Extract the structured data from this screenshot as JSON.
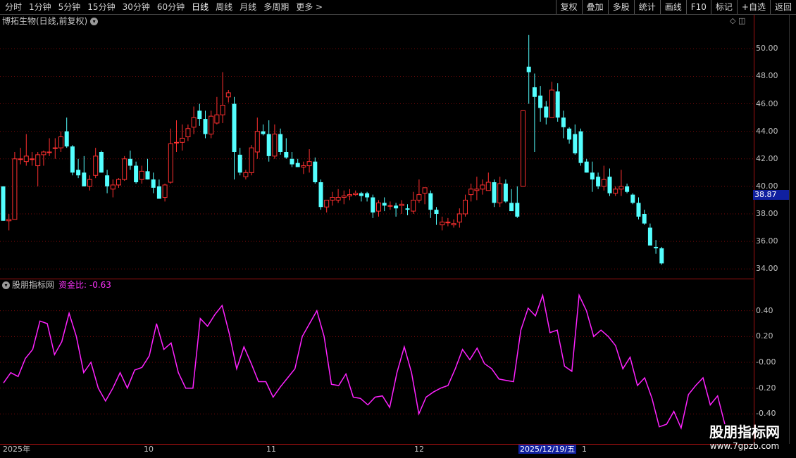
{
  "toolbar": {
    "periods": [
      "分时",
      "1分钟",
      "5分钟",
      "15分钟",
      "30分钟",
      "60分钟",
      "日线",
      "周线",
      "月线",
      "多周期",
      "更多 >"
    ],
    "active_period": "日线",
    "actions": [
      "复权",
      "叠加",
      "多股",
      "统计",
      "画线",
      "F10",
      "标记",
      "+自选",
      "返回"
    ]
  },
  "stock": {
    "title": "博拓生物(日线,前复权)"
  },
  "indicator": {
    "name": "股朋指标网",
    "fund_label": "资金比: -0.63"
  },
  "price_axis": {
    "ticks": [
      "50.00",
      "48.00",
      "46.00",
      "44.00",
      "42.00",
      "40.00",
      "38.00",
      "36.00",
      "34.00"
    ],
    "current": "38.87"
  },
  "ind_axis": {
    "ticks": [
      "0.40",
      "0.20",
      "-0.00",
      "-0.20",
      "-0.40"
    ]
  },
  "date_axis": {
    "labels": [
      "2025年",
      "10",
      "11",
      "12",
      "2025/12/19/五",
      "1"
    ]
  },
  "watermark": {
    "line1": "股朋指标网",
    "line2": "www.7gpzb.com"
  },
  "colors": {
    "up": "#ff3030",
    "down": "#54ffff",
    "line": "#ff22ff",
    "grid": "#7a0a0a"
  },
  "chart_data": [
    {
      "type": "candlestick",
      "title": "博拓生物(日线,前复权)",
      "ylim": [
        33.5,
        51.5
      ],
      "candles": [
        [
          40.0,
          40.0,
          37.5,
          37.5
        ],
        [
          37.5,
          38.0,
          36.8,
          37.6
        ],
        [
          37.6,
          42.5,
          37.6,
          42.0
        ],
        [
          42.0,
          42.8,
          41.6,
          42.0
        ],
        [
          41.8,
          43.8,
          41.5,
          42.2
        ],
        [
          42.0,
          42.5,
          41.5,
          42.0
        ],
        [
          41.5,
          42.5,
          40.0,
          42.3
        ],
        [
          42.3,
          42.6,
          41.5,
          42.5
        ],
        [
          42.5,
          43.5,
          42.2,
          42.5
        ],
        [
          42.8,
          43.5,
          42.0,
          42.8
        ],
        [
          42.8,
          44.0,
          42.5,
          43.6
        ],
        [
          44.0,
          45.0,
          42.8,
          42.9
        ],
        [
          42.9,
          43.0,
          40.8,
          41.0
        ],
        [
          41.2,
          42.0,
          40.6,
          40.8
        ],
        [
          41.0,
          42.2,
          40.0,
          40.0
        ],
        [
          40.0,
          40.8,
          39.7,
          40.5
        ],
        [
          40.8,
          42.8,
          40.6,
          42.2
        ],
        [
          42.5,
          42.6,
          41.0,
          41.0
        ],
        [
          40.8,
          41.2,
          39.5,
          40.0
        ],
        [
          39.8,
          40.5,
          39.2,
          40.1
        ],
        [
          40.1,
          40.6,
          39.9,
          40.5
        ],
        [
          40.5,
          42.2,
          40.4,
          42.0
        ],
        [
          42.0,
          42.6,
          41.2,
          41.5
        ],
        [
          41.5,
          41.8,
          40.2,
          40.3
        ],
        [
          40.5,
          41.5,
          40.2,
          41.1
        ],
        [
          41.1,
          42.0,
          40.5,
          40.5
        ],
        [
          40.5,
          41.0,
          39.5,
          39.9
        ],
        [
          40.0,
          40.5,
          39.2,
          39.1
        ],
        [
          39.2,
          40.2,
          38.9,
          40.1
        ],
        [
          40.3,
          44.2,
          40.2,
          43.1
        ],
        [
          43.2,
          44.8,
          42.5,
          43.2
        ],
        [
          43.2,
          44.5,
          42.6,
          43.5
        ],
        [
          43.6,
          44.5,
          43.3,
          44.2
        ],
        [
          44.3,
          45.8,
          43.8,
          45.0
        ],
        [
          45.5,
          46.0,
          44.4,
          44.9
        ],
        [
          44.9,
          45.5,
          43.5,
          43.8
        ],
        [
          43.8,
          45.5,
          43.5,
          45.1
        ],
        [
          44.6,
          46.5,
          44.5,
          45.2
        ],
        [
          45.2,
          48.3,
          44.6,
          45.9
        ],
        [
          46.5,
          47.0,
          46.1,
          46.8
        ],
        [
          46.0,
          46.5,
          40.5,
          42.5
        ],
        [
          42.3,
          42.8,
          40.8,
          41.0
        ],
        [
          40.7,
          41.2,
          40.5,
          41.0
        ],
        [
          41.0,
          43.0,
          40.8,
          42.8
        ],
        [
          42.5,
          45.0,
          42.0,
          44.0
        ],
        [
          44.0,
          44.5,
          43.7,
          43.8
        ],
        [
          43.8,
          44.8,
          41.8,
          42.2
        ],
        [
          42.2,
          44.5,
          42.0,
          43.8
        ],
        [
          43.8,
          44.2,
          42.3,
          42.5
        ],
        [
          42.5,
          43.5,
          42.0,
          42.1
        ],
        [
          42.0,
          42.5,
          41.4,
          41.6
        ],
        [
          41.7,
          42.0,
          41.4,
          41.4
        ],
        [
          41.4,
          41.8,
          40.9,
          41.5
        ],
        [
          41.5,
          42.7,
          41.0,
          41.8
        ],
        [
          41.8,
          42.1,
          40.2,
          40.3
        ],
        [
          40.3,
          40.5,
          38.3,
          38.5
        ],
        [
          38.5,
          38.8,
          38.1,
          39.0
        ],
        [
          39.0,
          39.6,
          38.6,
          39.2
        ],
        [
          39.0,
          39.8,
          38.8,
          39.2
        ],
        [
          39.2,
          39.7,
          38.7,
          39.3
        ],
        [
          39.3,
          39.8,
          39.0,
          39.4
        ],
        [
          39.4,
          39.7,
          39.3,
          39.5
        ],
        [
          39.5,
          39.6,
          38.9,
          39.3
        ],
        [
          39.5,
          39.6,
          38.9,
          39.2
        ],
        [
          39.2,
          39.4,
          37.7,
          38.1
        ],
        [
          38.2,
          39.0,
          37.8,
          38.8
        ],
        [
          38.8,
          39.2,
          38.2,
          38.6
        ],
        [
          38.6,
          38.9,
          38.3,
          38.6
        ],
        [
          38.6,
          38.8,
          37.8,
          38.4
        ],
        [
          38.6,
          39.0,
          38.0,
          38.7
        ],
        [
          38.4,
          38.7,
          37.9,
          38.3
        ],
        [
          38.2,
          39.6,
          38.0,
          39.0
        ],
        [
          39.0,
          40.5,
          38.8,
          39.4
        ],
        [
          39.5,
          39.9,
          38.7,
          39.9
        ],
        [
          39.5,
          39.7,
          37.7,
          38.3
        ],
        [
          38.3,
          38.5,
          37.2,
          38.0
        ],
        [
          37.2,
          37.8,
          36.8,
          37.4
        ],
        [
          37.4,
          37.7,
          37.1,
          37.4
        ],
        [
          37.2,
          37.6,
          37.0,
          37.3
        ],
        [
          37.4,
          38.4,
          37.0,
          38.0
        ],
        [
          38.0,
          39.4,
          37.8,
          39.0
        ],
        [
          39.4,
          40.2,
          38.9,
          39.8
        ],
        [
          39.7,
          40.7,
          39.0,
          39.8
        ],
        [
          39.8,
          40.5,
          39.4,
          40.1
        ],
        [
          39.7,
          41.0,
          39.7,
          40.3
        ],
        [
          40.3,
          40.5,
          38.5,
          38.8
        ],
        [
          38.8,
          40.7,
          38.5,
          40.2
        ],
        [
          40.2,
          40.5,
          38.8,
          38.9
        ],
        [
          38.8,
          39.8,
          38.3,
          38.2
        ],
        [
          38.8,
          40.0,
          37.7,
          37.8
        ],
        [
          40.0,
          45.5,
          40.0,
          45.5
        ],
        [
          48.7,
          51.0,
          46.0,
          48.3
        ],
        [
          47.2,
          48.2,
          42.5,
          46.5
        ],
        [
          46.6,
          47.3,
          44.7,
          45.7
        ],
        [
          45.8,
          46.2,
          44.5,
          45.0
        ],
        [
          45.0,
          47.6,
          45.0,
          47.0
        ],
        [
          46.9,
          47.5,
          44.7,
          45.0
        ],
        [
          45.0,
          45.5,
          43.5,
          44.3
        ],
        [
          44.2,
          44.3,
          43.1,
          43.4
        ],
        [
          43.8,
          44.5,
          42.3,
          42.4
        ],
        [
          44.0,
          44.2,
          41.5,
          41.7
        ],
        [
          41.8,
          42.0,
          41.0,
          41.0
        ],
        [
          41.0,
          41.8,
          39.6,
          40.5
        ],
        [
          40.7,
          41.0,
          39.8,
          40.0
        ],
        [
          40.0,
          41.5,
          39.7,
          40.5
        ],
        [
          40.7,
          41.3,
          39.3,
          39.5
        ],
        [
          39.5,
          40.0,
          39.3,
          39.8
        ],
        [
          39.8,
          41.2,
          39.3,
          40.0
        ],
        [
          40.0,
          40.2,
          39.5,
          39.6
        ],
        [
          39.4,
          39.5,
          38.7,
          38.8
        ],
        [
          38.8,
          39.2,
          37.6,
          37.8
        ],
        [
          38.0,
          38.3,
          37.2,
          37.3
        ],
        [
          37.0,
          37.3,
          35.8,
          35.7
        ],
        [
          35.6,
          36.1,
          35.1,
          35.5
        ],
        [
          35.5,
          35.6,
          34.3,
          34.4
        ]
      ]
    },
    {
      "type": "line",
      "title": "股朋指标网",
      "ylim": [
        -0.6,
        0.6
      ],
      "series": [
        {
          "name": "资金比",
          "values": [
            -0.16,
            -0.08,
            -0.11,
            0.03,
            0.1,
            0.32,
            0.3,
            0.06,
            0.16,
            0.38,
            0.2,
            -0.08,
            0.0,
            -0.2,
            -0.3,
            -0.2,
            -0.08,
            -0.2,
            -0.06,
            -0.04,
            0.05,
            0.3,
            0.1,
            0.15,
            -0.08,
            -0.2,
            -0.2,
            0.34,
            0.28,
            0.37,
            0.44,
            0.22,
            -0.05,
            0.12,
            -0.01,
            -0.15,
            -0.15,
            -0.27,
            -0.19,
            -0.12,
            -0.05,
            0.2,
            0.3,
            0.4,
            0.2,
            -0.17,
            -0.18,
            -0.09,
            -0.27,
            -0.28,
            -0.33,
            -0.27,
            -0.26,
            -0.35,
            -0.08,
            0.12,
            -0.08,
            -0.4,
            -0.27,
            -0.23,
            -0.2,
            -0.18,
            -0.05,
            0.1,
            0.02,
            0.11,
            -0.01,
            -0.05,
            -0.13,
            -0.14,
            -0.15,
            0.25,
            0.42,
            0.36,
            0.52,
            0.23,
            0.25,
            -0.03,
            -0.07,
            0.52,
            0.4,
            0.2,
            0.25,
            0.2,
            0.13,
            -0.05,
            0.04,
            -0.18,
            -0.12,
            -0.28,
            -0.5,
            -0.48,
            -0.38,
            -0.51,
            -0.25,
            -0.18,
            -0.12,
            -0.33,
            -0.26,
            -0.48
          ]
        }
      ]
    }
  ]
}
